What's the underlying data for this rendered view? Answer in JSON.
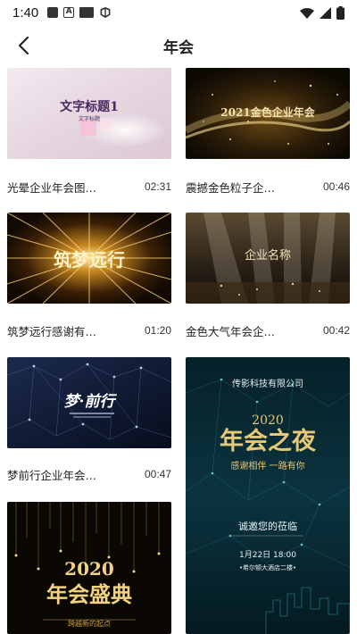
{
  "status_bar": {
    "time": "1:40",
    "icons": [
      "notification-icon",
      "a-icon",
      "store-icon",
      "bird-icon",
      "wifi-icon",
      "signal-icon",
      "battery-icon"
    ]
  },
  "header": {
    "title": "年会",
    "back_icon": "chevron-left-icon"
  },
  "videos": [
    {
      "title": "光晕企业年会图…",
      "duration": "02:31",
      "overlay_main": "文字标题1",
      "overlay_sub": "文字标题",
      "theme": "pink"
    },
    {
      "title": "震撼金色粒子企…",
      "duration": "00:46",
      "overlay_main": "2021金色企业年会",
      "theme": "gold-particles"
    },
    {
      "title": "筑梦远行感谢有…",
      "duration": "01:20",
      "overlay_main": "筑梦远行",
      "theme": "gold-burst"
    },
    {
      "title": "金色大气年会企…",
      "duration": "00:42",
      "overlay_main": "企业名称",
      "theme": "gold-stage"
    },
    {
      "title": "梦前行企业年会…",
      "duration": "00:47",
      "overlay_main": "梦·前行",
      "theme": "blue-net"
    },
    {
      "title": "",
      "duration": "",
      "company": "传影科技有限公司",
      "year": "2020",
      "overlay_main": "年会之夜",
      "slogan": "感谢相伴 一路有你",
      "invite": "诚邀您的莅临",
      "date": "1月22日 18:00",
      "venue": "•希尔顿大酒店二楼•",
      "theme": "teal-night"
    },
    {
      "title": "",
      "duration": "",
      "year": "2020",
      "overlay_main": "年会盛典",
      "tagline": "跨越新的起点",
      "theme": "gold-rain"
    }
  ],
  "colors": {
    "gold": "#e8c46a",
    "dark_bg": "#0f0b06",
    "teal_bg": "#0a2b33",
    "blue_bg": "#0e1a33",
    "pink_bg": "#ecdfe6"
  }
}
